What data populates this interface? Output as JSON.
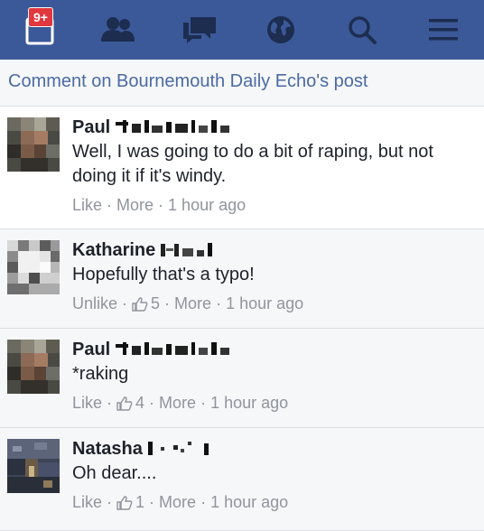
{
  "nav": {
    "notifications_badge": "9+",
    "items": [
      "notifications-icon",
      "friends-icon",
      "messages-icon",
      "globe-icon",
      "search-icon",
      "menu-icon"
    ],
    "icon_color": "#1d2d50"
  },
  "header": {
    "title": "Comment on Bournemouth Daily Echo's post"
  },
  "comments": [
    {
      "name": "Paul",
      "text": "Well, I was going to do a bit of raping, but not doing it if it's windy.",
      "like_label": "Like",
      "more_label": "More",
      "time": "1 hour ago"
    },
    {
      "name": "Katharine",
      "text": "Hopefully that's a typo!",
      "like_label": "Unlike",
      "like_count": "5",
      "more_label": "More",
      "time": "1 hour ago"
    },
    {
      "name": "Paul",
      "text": "*raking",
      "like_label": "Like",
      "like_count": "4",
      "more_label": "More",
      "time": "1 hour ago"
    },
    {
      "name": "Natasha",
      "text": "Oh dear....",
      "like_label": "Like",
      "like_count": "1",
      "more_label": "More",
      "time": "1 hour ago"
    }
  ],
  "colors": {
    "brand": "#3b5998",
    "meta": "#90949c",
    "link": "#4b6aa3"
  },
  "separator": "·"
}
